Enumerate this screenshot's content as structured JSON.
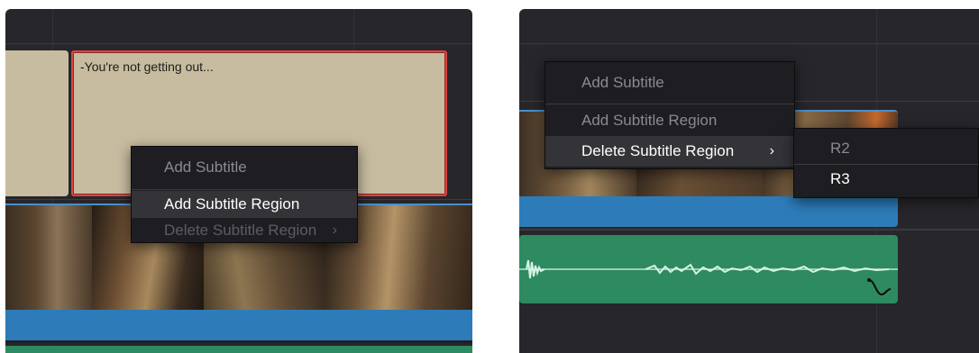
{
  "left_panel": {
    "subtitle_clip_text": "-You're not getting out...",
    "context_menu": {
      "items": [
        {
          "label": "Add Subtitle",
          "state": "disabled"
        },
        {
          "label": "Add Subtitle Region",
          "state": "active"
        },
        {
          "label": "Delete Subtitle Region",
          "state": "dim",
          "has_submenu": true
        }
      ]
    }
  },
  "right_panel": {
    "context_menu": {
      "items": [
        {
          "label": "Add Subtitle",
          "state": "disabled"
        },
        {
          "label": "Add Subtitle Region",
          "state": "disabled"
        },
        {
          "label": "Delete Subtitle Region",
          "state": "active",
          "has_submenu": true
        }
      ],
      "submenu": [
        {
          "label": "R2",
          "state": "disabled"
        },
        {
          "label": "R3",
          "state": "enabled"
        }
      ]
    }
  },
  "icons": {
    "submenu_arrow": "chevron-right-icon",
    "audio_curve": "audio-fade-curve-icon"
  },
  "colors": {
    "timeline_bg": "#26262b",
    "subtitle_clip": "#c7bca0",
    "selected_border": "#e0433e",
    "video_track": "#2d7cb9",
    "audio_track": "#2d8a61"
  }
}
